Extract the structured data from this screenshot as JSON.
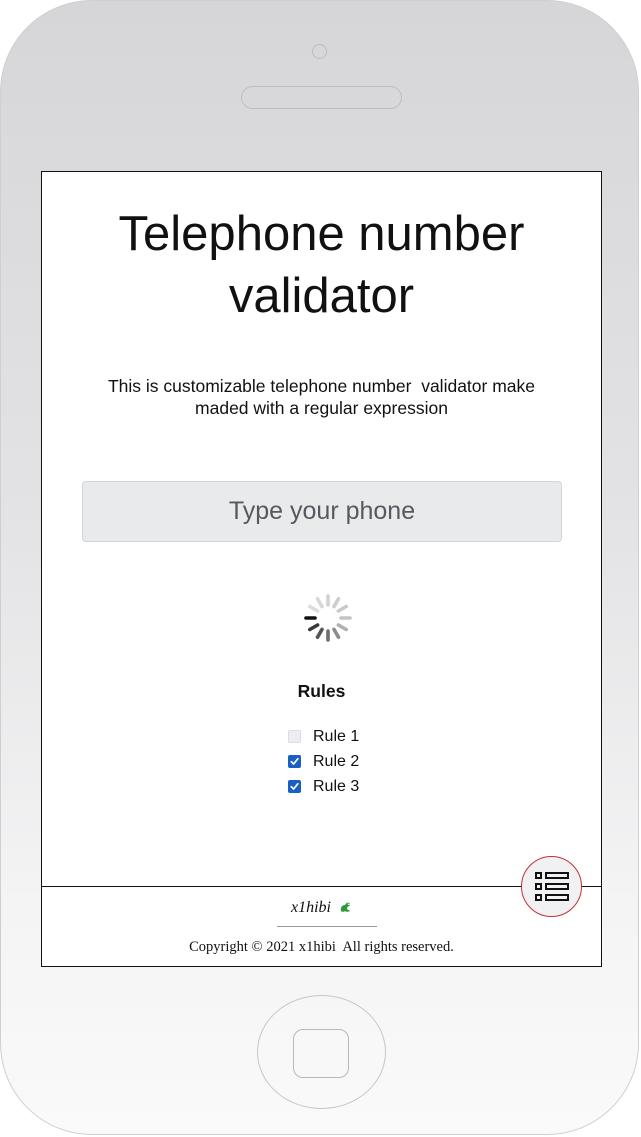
{
  "app": {
    "title": "Telephone number validator",
    "description": "This is customizable telephone number  validator make maded with a regular expression"
  },
  "phone_input": {
    "placeholder": "Type your phone",
    "value": ""
  },
  "loading_indicator": "spinner-icon",
  "rules": {
    "title": "Rules",
    "items": [
      {
        "label": "Rule 1",
        "checked": false
      },
      {
        "label": "Rule 2",
        "checked": true
      },
      {
        "label": "Rule 3",
        "checked": true
      }
    ]
  },
  "footer": {
    "author": "x1hibi",
    "author_icon": "dragon-icon",
    "copyright": "Copyright © 2021 x1hibi  All rights reserved."
  },
  "menu_button": {
    "icon": "list-icon"
  },
  "colors": {
    "accent": "#1a5fc4",
    "menu_border": "#c2303a",
    "input_background": "#e9eaec",
    "dragon_icon": "#2e9a3a"
  }
}
